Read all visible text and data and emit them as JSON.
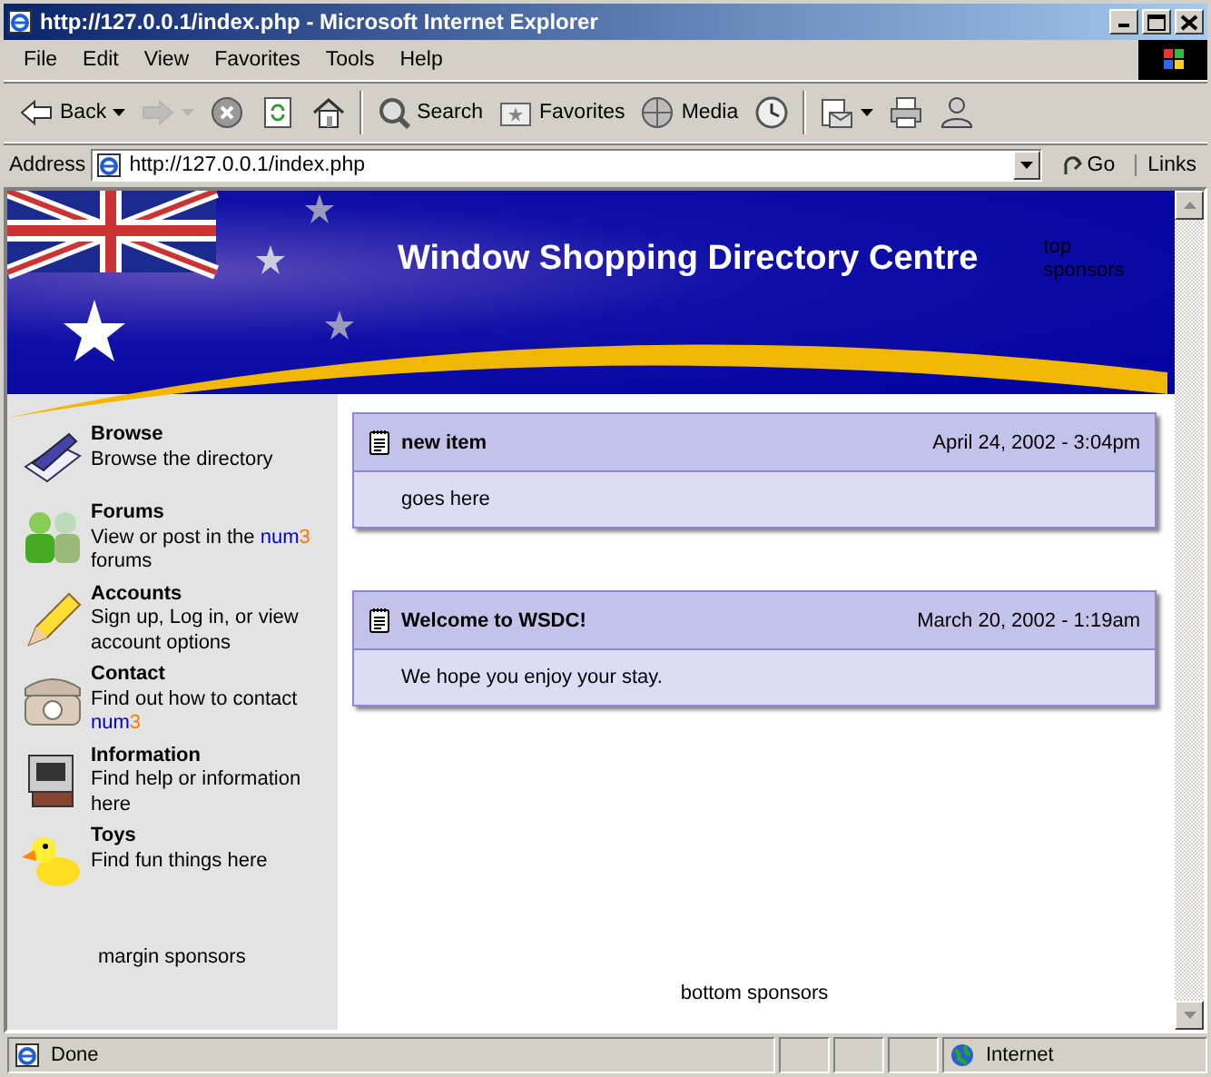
{
  "window": {
    "title": "http://127.0.0.1/index.php - Microsoft Internet Explorer"
  },
  "menu": [
    "File",
    "Edit",
    "View",
    "Favorites",
    "Tools",
    "Help"
  ],
  "toolbar": [
    {
      "kind": "back",
      "label": "Back",
      "dropdown": true,
      "disabled": false
    },
    {
      "kind": "forward",
      "dropdown": true,
      "disabled": true
    },
    {
      "kind": "stop",
      "dropdown": false,
      "disabled": false
    },
    {
      "kind": "refresh",
      "dropdown": false,
      "disabled": false
    },
    {
      "kind": "home",
      "dropdown": false,
      "disabled": false
    },
    {
      "kind": "separator"
    },
    {
      "kind": "search",
      "label": "Search",
      "dropdown": false,
      "disabled": false
    },
    {
      "kind": "favorites",
      "label": "Favorites",
      "dropdown": false,
      "disabled": false
    },
    {
      "kind": "media",
      "label": "Media",
      "dropdown": false,
      "disabled": false
    },
    {
      "kind": "history",
      "dropdown": false,
      "disabled": false
    },
    {
      "kind": "separator"
    },
    {
      "kind": "mail",
      "dropdown": true,
      "disabled": false
    },
    {
      "kind": "print",
      "dropdown": false,
      "disabled": false
    },
    {
      "kind": "messenger",
      "dropdown": false,
      "disabled": false
    }
  ],
  "address": {
    "label": "Address",
    "value": "http://127.0.0.1/index.php",
    "go": "Go",
    "links": "Links"
  },
  "banner": {
    "title": "Window Shopping Directory Centre",
    "sponsors": "top sponsors"
  },
  "sidebar": {
    "items": [
      {
        "kind": "book",
        "title": "Browse",
        "description": [
          {
            "kind": "text",
            "text": "Browse the directory"
          }
        ]
      },
      {
        "kind": "people",
        "title": "Forums",
        "description": [
          {
            "kind": "text",
            "text": "View or post in the "
          },
          {
            "kind": "link",
            "parts": [
              "num",
              "3"
            ]
          },
          {
            "kind": "text",
            "text": " forums"
          }
        ]
      },
      {
        "kind": "pencil",
        "title": "Accounts",
        "description": [
          {
            "kind": "text",
            "text": "Sign up, Log in, or view account options"
          }
        ]
      },
      {
        "kind": "phone",
        "title": "Contact",
        "description": [
          {
            "kind": "text",
            "text": "Find out how to contact "
          },
          {
            "kind": "link",
            "parts": [
              "num",
              "3"
            ]
          }
        ]
      },
      {
        "kind": "computer",
        "title": "Information",
        "description": [
          {
            "kind": "text",
            "text": "Find help or information here"
          }
        ]
      },
      {
        "kind": "duck",
        "title": "Toys",
        "description": [
          {
            "kind": "text",
            "text": "Find fun things here"
          }
        ]
      }
    ],
    "sponsors": "margin sponsors"
  },
  "news": [
    {
      "title": "new item",
      "date": "April 24, 2002 - 3:04pm",
      "body": "goes here"
    },
    {
      "title": "Welcome to WSDC!",
      "date": "March 20, 2002 - 1:19am",
      "body": "We hope you enjoy your stay."
    }
  ],
  "bottom_sponsors": "bottom sponsors",
  "status_bar": {
    "text": "Done",
    "zone": "Internet"
  }
}
